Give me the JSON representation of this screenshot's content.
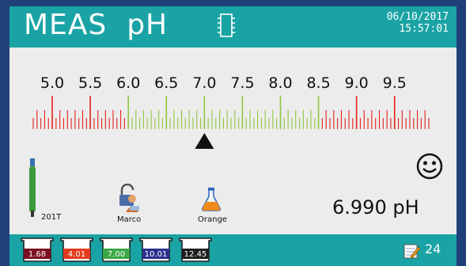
{
  "header": {
    "mode": "MEAS",
    "parameter": "pH",
    "date": "06/10/2017",
    "time": "15:57:01"
  },
  "scale": {
    "tick_labels": [
      "5.0",
      "5.5",
      "6.0",
      "6.5",
      "7.0",
      "7.5",
      "8.0",
      "8.5",
      "9.0",
      "9.5"
    ],
    "min": 4.75,
    "max": 9.95,
    "green_range": [
      6.0,
      8.5
    ],
    "pointer_value": 7.0,
    "colors": {
      "red": "#e8201a",
      "green": "#8ec63f",
      "pointer": "#111111"
    }
  },
  "sensor": {
    "label": "201T",
    "icon": "electrode-icon"
  },
  "user": {
    "label": "Marco",
    "icon": "unlocked-user-icon"
  },
  "sample": {
    "label": "Orange",
    "icon": "flask-icon"
  },
  "status": {
    "icon": "smiley-icon"
  },
  "reading": {
    "text": "6.990 pH"
  },
  "buffers": [
    {
      "value": "1.68",
      "color": "#7a1020"
    },
    {
      "value": "4.01",
      "color": "#e23b1f"
    },
    {
      "value": "7.00",
      "color": "#3aa845"
    },
    {
      "value": "10.01",
      "color": "#2d2f8f"
    },
    {
      "value": "12.45",
      "color": "#1e1e1e"
    }
  ],
  "notes": {
    "icon": "notepad-icon",
    "count": "24"
  }
}
